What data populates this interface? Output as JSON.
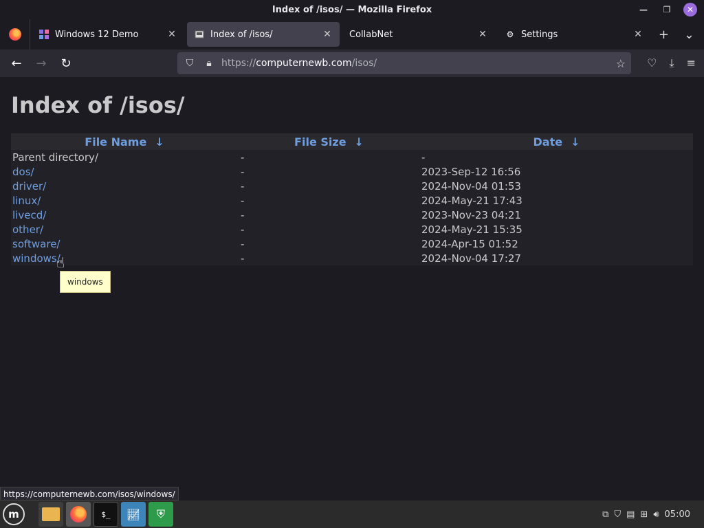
{
  "window": {
    "title": "Index of /isos/ — Mozilla Firefox"
  },
  "tabs": [
    {
      "label": "Windows 12 Demo",
      "icon": "windows-tiles-icon"
    },
    {
      "label": "Index of /isos/",
      "icon": "folder-favicon-icon",
      "active": true
    },
    {
      "label": "CollabNet",
      "icon": ""
    },
    {
      "label": "Settings",
      "icon": "gear-icon"
    }
  ],
  "urlbar": {
    "scheme": "https://",
    "host": "computernewb.com",
    "path": "/isos/"
  },
  "page": {
    "heading": "Index of /isos/",
    "columns": [
      {
        "label": "File Name",
        "arrow": "↓"
      },
      {
        "label": "File Size",
        "arrow": "↓"
      },
      {
        "label": "Date",
        "arrow": "↓"
      }
    ],
    "rows": [
      {
        "name": "Parent directory/",
        "size": "-",
        "date": "-",
        "link": false
      },
      {
        "name": "dos/",
        "size": "-",
        "date": "2023-Sep-12 16:56",
        "link": true
      },
      {
        "name": "driver/",
        "size": "-",
        "date": "2024-Nov-04 01:53",
        "link": true
      },
      {
        "name": "linux/",
        "size": "-",
        "date": "2024-May-21 17:43",
        "link": true
      },
      {
        "name": "livecd/",
        "size": "-",
        "date": "2023-Nov-23 04:21",
        "link": true
      },
      {
        "name": "other/",
        "size": "-",
        "date": "2024-May-21 15:35",
        "link": true
      },
      {
        "name": "software/",
        "size": "-",
        "date": "2024-Apr-15 01:52",
        "link": true
      },
      {
        "name": "windows/",
        "size": "-",
        "date": "2024-Nov-04 17:27",
        "link": true
      }
    ],
    "tooltip": "windows"
  },
  "status": {
    "link_url": "https://computernewb.com/isos/windows/"
  },
  "taskbar": {
    "clock": "05:00",
    "terminal_glyph": "$_"
  }
}
